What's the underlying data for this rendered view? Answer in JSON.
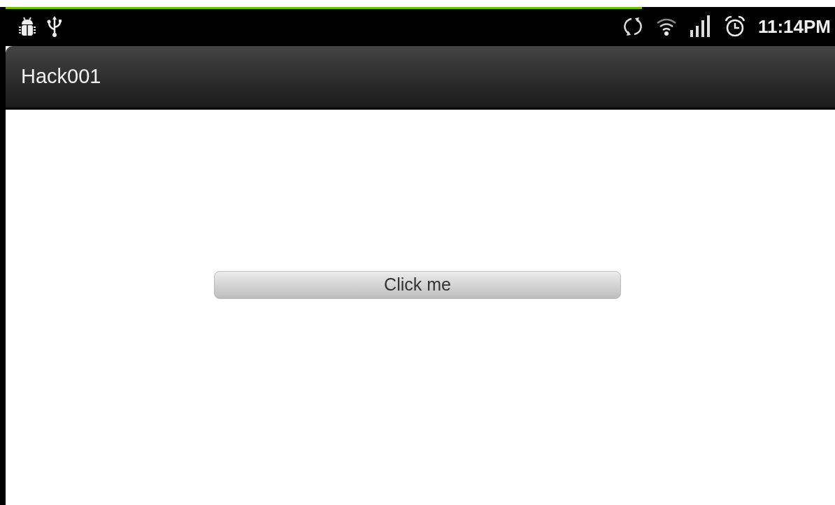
{
  "status_bar": {
    "time": "11:14PM"
  },
  "action_bar": {
    "title": "Hack001"
  },
  "button": {
    "label": "Click me"
  }
}
